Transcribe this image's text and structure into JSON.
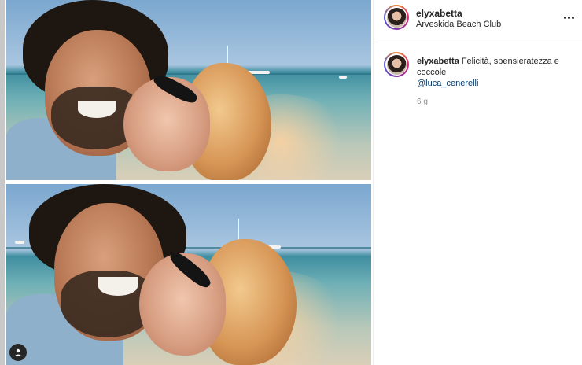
{
  "post": {
    "username": "elyxabetta",
    "location": "Arveskida Beach Club",
    "more_icon": "more-horizontal-icon"
  },
  "caption": {
    "username": "elyxabetta",
    "text": "Felicità, spensieratezza e coccole",
    "mention": "@luca_cenerelli",
    "time": "6 g"
  },
  "media": {
    "photos": [
      "photo-1",
      "photo-2"
    ],
    "tag_icon": "user-tag-icon"
  },
  "colors": {
    "accent_link": "#00376b",
    "muted": "#8e8e8e",
    "text": "#262626"
  }
}
